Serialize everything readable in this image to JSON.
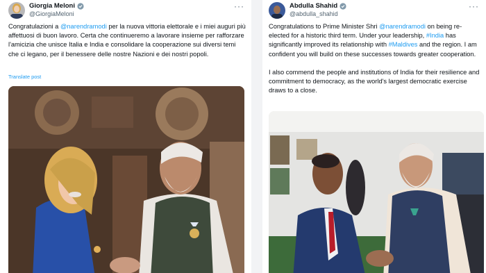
{
  "left_post": {
    "display_name": "Giorgia Meloni",
    "handle": "@GiorgiaMeloni",
    "text_start": "Congratulazioni a ",
    "mention": "@narendramodi",
    "text_end": " per la nuova vittoria elettorale e i miei auguri più affettuosi di buon lavoro. Certa che continueremo a lavorare insieme per rafforzare l'amicizia che unisce Italia e India e consolidare la cooperazione sui diversi temi che ci legano, per il benessere delle nostre Nazioni e dei nostri popoli.",
    "translate_label": "Translate post",
    "more_label": "···"
  },
  "right_post": {
    "display_name": "Abdulla Shahid",
    "handle": "@abdulla_shahid",
    "p1_a": "Congratulations to Prime Minister Shri ",
    "p1_mention": "@narendramodi",
    "p1_b": " on being re-elected for a historic third term. Under your leadership, ",
    "p1_hashtag1": "#India",
    "p1_c": " has significantly improved its relationship with ",
    "p1_hashtag2": "#Maldives",
    "p1_d": " and the region. I am confident you will build on these successes towards greater cooperation.",
    "p2": "I also commend the people and institutions of India for their resilience and commitment to democracy, as the world's largest democratic exercise draws to a close.",
    "more_label": "···"
  },
  "colors": {
    "link": "#1d9bf0",
    "verified": "#829aab",
    "text": "#0f1419",
    "muted": "#536471"
  }
}
